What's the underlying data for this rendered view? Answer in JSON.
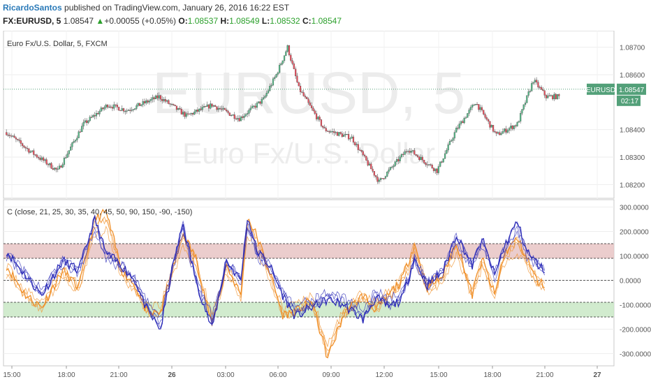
{
  "header": {
    "author": "RicardoSantos",
    "published_text": "published on TradingView.com, January 26, 2016 16:22 EST",
    "symbol": "FX:EURUSD, 5",
    "last": "1.08547",
    "change_arrow": "▲",
    "change": "+0.00055 (+0.05%)",
    "o_label": "O:",
    "o_value": "1.08537",
    "h_label": "H:",
    "h_value": "1.08549",
    "l_label": "L:",
    "l_value": "1.08532",
    "c_label": "C:",
    "c_value": "1.08547"
  },
  "price_pane": {
    "legend": "Euro Fx/U.S. Dollar, 5, FXCM",
    "watermark_main": "EURUSD, 5",
    "watermark_sub": "Euro Fx/U.S. Dollar",
    "price_tag_symbol": "EURUSD",
    "price_tag_value": "1.08547",
    "countdown": "02:17"
  },
  "indicator_pane": {
    "legend": "C (close, 21, 25, 30, 35, 40, 45, 50, 90, 150, -90, -150)"
  },
  "colors": {
    "up": "#53b987",
    "down": "#eb4d5c",
    "upper_band": "#e8c4c4",
    "lower_band": "#c9e8c5",
    "blue_series": "#2d2db8",
    "orange_series": "#f0902a",
    "tag_bg": "#53a079",
    "author": "#2a7ab8"
  },
  "chart_data": [
    {
      "type": "candlestick",
      "y_ticks": [
        "1.08700",
        "1.08600",
        "1.08400",
        "1.08300",
        "1.08200"
      ],
      "ylim": [
        1.0815,
        1.0876
      ],
      "x_ticks": [
        "15:00",
        "18:00",
        "21:00",
        "26",
        "03:00",
        "06:00",
        "09:00",
        "12:00",
        "15:00",
        "18:00",
        "21:00",
        "27"
      ],
      "last_price": 1.08547,
      "path_anchors": [
        [
          0,
          1.0839
        ],
        [
          15,
          1.0832
        ],
        [
          32,
          1.0825
        ],
        [
          48,
          1.0842
        ],
        [
          63,
          1.0849
        ],
        [
          75,
          1.0847
        ],
        [
          95,
          1.0852
        ],
        [
          112,
          1.0845
        ],
        [
          128,
          1.0849
        ],
        [
          145,
          1.0844
        ],
        [
          160,
          1.0851
        ],
        [
          168,
          1.086
        ],
        [
          175,
          1.087
        ],
        [
          182,
          1.0855
        ],
        [
          198,
          1.084
        ],
        [
          215,
          1.0837
        ],
        [
          232,
          1.0821
        ],
        [
          250,
          1.0833
        ],
        [
          268,
          1.0825
        ],
        [
          280,
          1.084
        ],
        [
          292,
          1.085
        ],
        [
          305,
          1.0838
        ],
        [
          318,
          1.0842
        ],
        [
          328,
          1.0858
        ],
        [
          336,
          1.0852
        ],
        [
          344,
          1.0852
        ]
      ]
    },
    {
      "type": "line",
      "y_ticks": [
        "300.0000",
        "200.0000",
        "100.0000",
        "0.0000",
        "-100.0000",
        "-200.0000",
        "-300.0000"
      ],
      "ylim": [
        -350,
        330
      ],
      "bands": [
        [
          90,
          150
        ],
        [
          -150,
          -90
        ]
      ],
      "series_colors": [
        "#2d2db8",
        "#f0902a"
      ],
      "blue_anchors": [
        [
          0,
          120
        ],
        [
          12,
          20
        ],
        [
          22,
          -60
        ],
        [
          35,
          80
        ],
        [
          45,
          40
        ],
        [
          55,
          250
        ],
        [
          62,
          110
        ],
        [
          72,
          60
        ],
        [
          80,
          0
        ],
        [
          88,
          -130
        ],
        [
          96,
          -200
        ],
        [
          104,
          70
        ],
        [
          110,
          230
        ],
        [
          118,
          0
        ],
        [
          128,
          -200
        ],
        [
          137,
          80
        ],
        [
          146,
          0
        ],
        [
          150,
          260
        ],
        [
          156,
          120
        ],
        [
          164,
          60
        ],
        [
          172,
          -60
        ],
        [
          180,
          -150
        ],
        [
          190,
          -110
        ],
        [
          200,
          -80
        ],
        [
          210,
          -100
        ],
        [
          222,
          -160
        ],
        [
          230,
          -70
        ],
        [
          238,
          -110
        ],
        [
          246,
          -80
        ],
        [
          254,
          90
        ],
        [
          262,
          -20
        ],
        [
          272,
          40
        ],
        [
          280,
          190
        ],
        [
          290,
          60
        ],
        [
          296,
          170
        ],
        [
          304,
          20
        ],
        [
          310,
          140
        ],
        [
          318,
          240
        ],
        [
          324,
          120
        ],
        [
          330,
          70
        ],
        [
          335,
          40
        ]
      ],
      "orange_anchors": [
        [
          0,
          60
        ],
        [
          12,
          -60
        ],
        [
          22,
          -110
        ],
        [
          35,
          40
        ],
        [
          45,
          -30
        ],
        [
          55,
          250
        ],
        [
          62,
          280
        ],
        [
          72,
          40
        ],
        [
          80,
          -20
        ],
        [
          88,
          -140
        ],
        [
          96,
          -130
        ],
        [
          104,
          60
        ],
        [
          110,
          190
        ],
        [
          118,
          90
        ],
        [
          128,
          -180
        ],
        [
          137,
          60
        ],
        [
          146,
          -60
        ],
        [
          150,
          260
        ],
        [
          156,
          180
        ],
        [
          164,
          30
        ],
        [
          172,
          -140
        ],
        [
          180,
          -130
        ],
        [
          190,
          -80
        ],
        [
          200,
          -320
        ],
        [
          210,
          -140
        ],
        [
          222,
          -60
        ],
        [
          230,
          -120
        ],
        [
          238,
          -60
        ],
        [
          246,
          0
        ],
        [
          254,
          150
        ],
        [
          262,
          -30
        ],
        [
          272,
          20
        ],
        [
          280,
          160
        ],
        [
          290,
          -60
        ],
        [
          296,
          90
        ],
        [
          304,
          -60
        ],
        [
          310,
          110
        ],
        [
          318,
          170
        ],
        [
          324,
          90
        ],
        [
          330,
          0
        ],
        [
          335,
          -20
        ]
      ]
    }
  ]
}
